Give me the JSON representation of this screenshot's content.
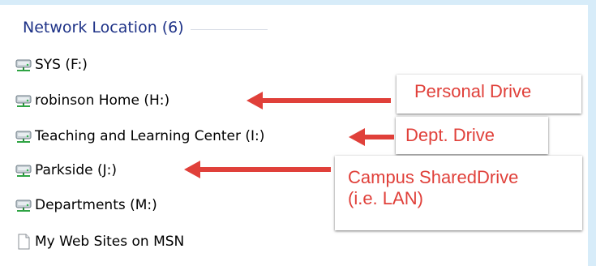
{
  "group": {
    "title": "Network Location (6)"
  },
  "items": [
    {
      "label": "SYS (F:)",
      "icon": "network-drive-icon"
    },
    {
      "label": "robinson Home (H:)",
      "icon": "network-drive-icon"
    },
    {
      "label": "Teaching and Learning Center (I:)",
      "icon": "network-drive-icon"
    },
    {
      "label": "Parkside (J:)",
      "icon": "network-drive-icon"
    },
    {
      "label": "Departments (M:)",
      "icon": "network-drive-icon"
    },
    {
      "label": "My Web Sites on MSN",
      "icon": "document-icon"
    }
  ],
  "callouts": {
    "personal": "Personal Drive",
    "dept": "Dept. Drive",
    "campus_line1": "Campus SharedDrive",
    "campus_line2": "(i.e. LAN)"
  },
  "colors": {
    "accent": "#e0403a",
    "header_text": "#1e3287",
    "frame": "#d7ecf9"
  }
}
